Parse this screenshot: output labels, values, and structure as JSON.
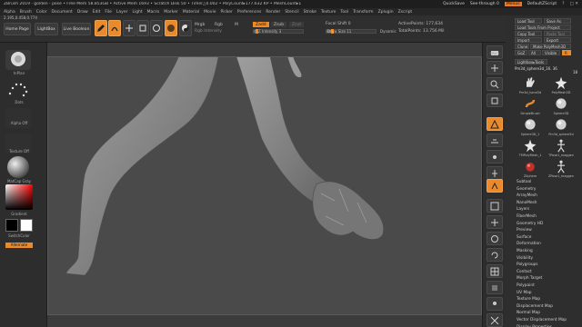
{
  "titlebar": {
    "title": "ZBrush 2019 · golden - pose  • Free Mem 58.853GB • Active Mem 1693 • Scratch Disk 50 • Timer△0.002 • PolyCount▸177.632 KP • MeshCount▸1",
    "quicksave": "QuickSave",
    "see_through": "See-through 0",
    "menus_label": "Menus",
    "script": "DefaultZScript"
  },
  "menubar": [
    "Alpha",
    "Brush",
    "Color",
    "Document",
    "Draw",
    "Edit",
    "File",
    "Layer",
    "Light",
    "Macro",
    "Marker",
    "Material",
    "Movie",
    "Picker",
    "Preferences",
    "Render",
    "Stencil",
    "Stroke",
    "Texture",
    "Tool",
    "Transform",
    "Zplugin",
    "Zscript"
  ],
  "shelf": {
    "coords": "2.195,0.458,0.774",
    "home_page": "Home Page",
    "lightbox": "LightBox",
    "live_boolean": "Live Boolean",
    "edit": "Edit",
    "draw": "Draw",
    "move": "Move",
    "scale": "Scale",
    "rotate": "Rotate",
    "mrgb": "Mrgb",
    "rgb": "Rgb",
    "m": "M",
    "zadd": "Zadd",
    "zsub": "Zsub",
    "zcut": "Zcut",
    "rgb_intensity": "Rgb Intensity",
    "z_intensity": "Z Intensity 3",
    "focal_shift": "Focal Shift 0",
    "draw_size": "Draw Size 11",
    "dynamic": "Dynamic",
    "active_points": "ActivePoints: 177,634",
    "total_points": "TotalPoints: 13.756 Mil",
    "z_intensity_level": 0.03,
    "draw_size_level": 0.1
  },
  "lefttray": {
    "brush": "InPlan",
    "stroke": "Dots",
    "alpha": "Alpha Off",
    "texture": "Texture Off",
    "material": "MatCap Gray",
    "gradient": "Gradient",
    "switch_color": "SwitchColor",
    "alternate": "Alternate"
  },
  "rightcol": {
    "bpr": "BPR",
    "spix": "SPix 3",
    "scroll": "Scroll",
    "zoom": "Zoom",
    "actual": "Actual",
    "aahalf": "AAHalf",
    "persp": "Persp",
    "floor": "Floor",
    "local": "Local",
    "lsym": "L.Sym",
    "xyz": "Gxyz",
    "frame": "Frame",
    "move": "Move",
    "zoom3d": "Zoom3D",
    "rotate": "Rotate",
    "line_fill": "Line Fill",
    "polyf": "PolyF",
    "transp": "Transp",
    "ghost": "Ghost",
    "solo": "Solo",
    "xpose": "Xpose"
  },
  "palette": {
    "load_tool": "Load Tool",
    "save_as": "Save As",
    "load_tools_from_project": "Load Tools From Project",
    "copy_tool": "Copy Tool",
    "paste_tool": "Paste Tool",
    "import": "Import",
    "export": "Export",
    "clone": "Clone",
    "make_polymesh3d": "Make PolyMesh3D",
    "goz": "GoZ",
    "all": "All",
    "visible": "Visible",
    "r": "R",
    "lightbox_tools": "Lightbox▸Tools",
    "current_tool": "Pm3d_sphere3d_16. 36",
    "count": "18",
    "r_label": "R",
    "thumbs": [
      {
        "name": "Pm3d_hand3d",
        "icon": "hand-icon"
      },
      {
        "name": "PolyMesh3D",
        "icon": "polymesh-star-icon"
      },
      {
        "name": "SimpleBrush",
        "icon": "simplebrush-icon"
      },
      {
        "name": "Sphere3D",
        "icon": "sphere-icon"
      },
      {
        "name": "Sphere3D_1",
        "icon": "sphere-icon"
      },
      {
        "name": "Pm3d_sphere3d",
        "icon": "sphere-icon"
      },
      {
        "name": "TMPolyMesh_1",
        "icon": "polymesh-star-icon"
      },
      {
        "name": "TPose1_maggen",
        "icon": "figure-icon"
      },
      {
        "name": "ZSphere",
        "icon": "zsphere-icon"
      },
      {
        "name": "ZPose1_maggen",
        "icon": "figure-icon"
      }
    ],
    "subpalettes": [
      "Subtool",
      "Geometry",
      "ArrayMesh",
      "NanoMesh",
      "Layers",
      "FiberMesh",
      "Geometry HD",
      "Preview",
      "Surface",
      "Deformation",
      "Masking",
      "Visibility",
      "Polygroups",
      "Contact",
      "Morph Target",
      "Polypaint",
      "UV Map",
      "Texture Map",
      "Displacement Map",
      "Normal Map",
      "Vector Displacement Map",
      "Display Properties"
    ]
  },
  "colors": {
    "accent": "#e98b2c",
    "background": "#2b2b2b",
    "viewport": "#4a4a4a",
    "model": "#8a8a8a"
  }
}
